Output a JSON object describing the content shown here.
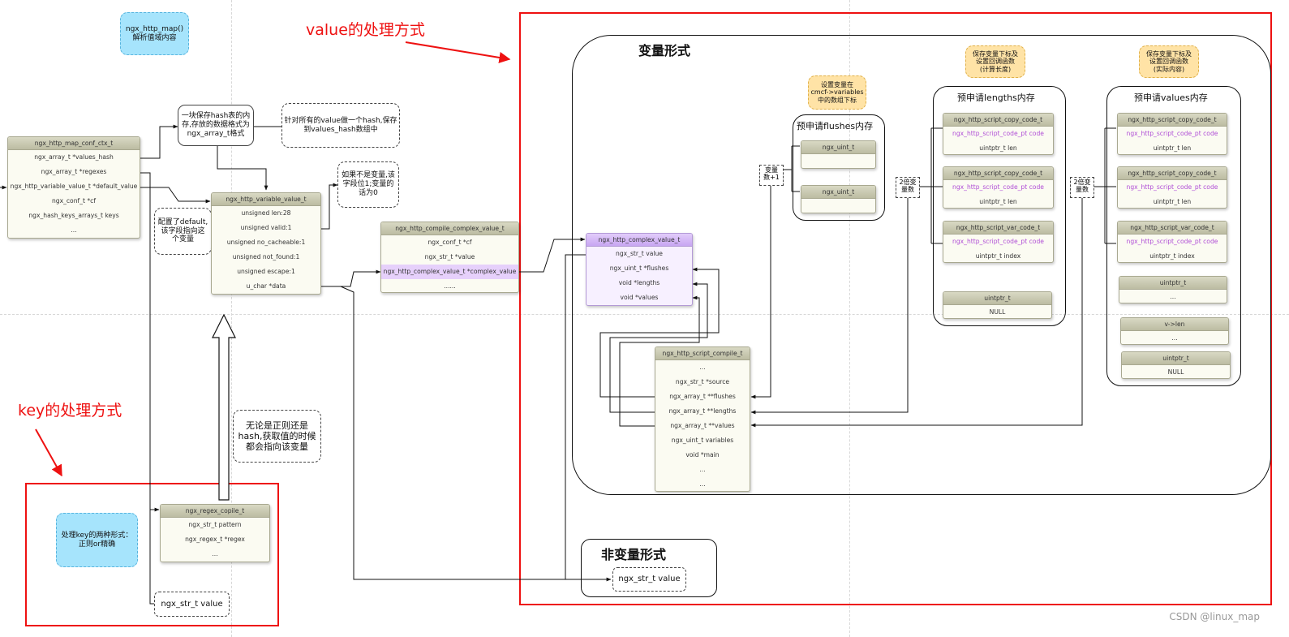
{
  "annotations": {
    "value_title": "value的处理方式",
    "key_title": "key的处理方式",
    "map_parse": "ngx_http_map()\n解析值域内容",
    "key_forms": "处理key的两种形式：\n正则or精确",
    "hash_mem": "一块保存hash表的内\n存,存放的数据格式为\nngx_array_t格式",
    "hash_values": "针对所有的value做一个hash,保存\n到values_hash数组中",
    "not_variable": "如果不是变量,该\n字段位1;变量的\n话为0",
    "default_note": "配置了default,\n该字段指向这\n个变量",
    "regex_note": "无论是正则还是\nhash,获取值的时候\n都会指向该变量",
    "set_var_idx": "设置变量在\ncmcf->variables\n中的数组下标",
    "save_idx_len": "保存变量下标及\n设置回调函数\n(计算长度)",
    "save_idx_real": "保存变量下标及\n设置回调函数\n(实际内容)",
    "var_count_plus1": "变量\n数+1",
    "double_var_count_a": "2倍变\n量数",
    "double_var_count_b": "2倍变\n量数"
  },
  "sections": {
    "variable_form": "变量形式",
    "non_variable_form": "非变量形式",
    "flushes_mem": "预申请flushes内存",
    "lengths_mem": "预申请lengths内存",
    "values_mem": "预申请values内存"
  },
  "structs": {
    "map_conf_ctx": {
      "title": "ngx_http_map_conf_ctx_t",
      "rows": [
        "ngx_array_t *values_hash",
        "ngx_array_t *regexes",
        "ngx_http_variable_value_t *default_value",
        "ngx_conf_t  *cf",
        "ngx_hash_keys_arrays_t  keys",
        "..."
      ]
    },
    "variable_value": {
      "title": "ngx_http_variable_value_t",
      "rows": [
        "unsigned    len:28",
        "unsigned valid:1",
        "unsigned  no_cacheable:1",
        "unsigned not_found:1",
        "unsigned escape:1",
        "u_char *data"
      ]
    },
    "compile_complex": {
      "title": "ngx_http_compile_complex_value_t",
      "rows": [
        "ngx_conf_t  *cf",
        "ngx_str_t  *value",
        "ngx_http_complex_value_t  *complex_value",
        "......"
      ]
    },
    "complex_value": {
      "title": "ngx_http_complex_value_t",
      "rows": [
        "ngx_str_t  value",
        "ngx_uint_t  *flushes",
        "void *lengths",
        "void  *values"
      ]
    },
    "script_compile": {
      "title": "ngx_http_script_compile_t",
      "rows": [
        "...",
        "ngx_str_t *source",
        "ngx_array_t **flushes",
        "ngx_array_t **lengths",
        "ngx_array_t **values",
        "ngx_uint_t variables",
        "void *main",
        "...",
        "..."
      ]
    },
    "regex_compile": {
      "title": "ngx_regex_copile_t",
      "rows": [
        "ngx_str_t pattern",
        "ngx_regex_t *regex",
        "..."
      ]
    },
    "flush1": {
      "title": "ngx_uint_t",
      "rows": [
        ""
      ]
    },
    "flush2": {
      "title": "ngx_uint_t",
      "rows": [
        ""
      ]
    },
    "len_copy1": {
      "title": "ngx_http_script_copy_code_t",
      "rows": [
        "ngx_http_script_code_pt  code",
        "uintptr_t len"
      ]
    },
    "len_copy2": {
      "title": "ngx_http_script_copy_code_t",
      "rows": [
        "ngx_http_script_code_pt  code",
        "uintptr_t len"
      ]
    },
    "len_var": {
      "title": "ngx_http_script_var_code_t",
      "rows": [
        "ngx_http_script_code_pt  code",
        "uintptr_t index"
      ]
    },
    "len_null": {
      "title": "uintptr_t",
      "rows": [
        "NULL"
      ]
    },
    "val_copy1": {
      "title": "ngx_http_script_copy_code_t",
      "rows": [
        "ngx_http_script_code_pt  code",
        "uintptr_t len"
      ]
    },
    "val_copy2": {
      "title": "ngx_http_script_copy_code_t",
      "rows": [
        "ngx_http_script_code_pt  code",
        "uintptr_t len"
      ]
    },
    "val_var": {
      "title": "ngx_http_script_var_code_t",
      "rows": [
        "ngx_http_script_code_pt  code",
        "uintptr_t index"
      ]
    },
    "val_uintptr": {
      "title": "uintptr_t",
      "rows": [
        "..."
      ]
    },
    "val_vlen": {
      "title": "v->len",
      "rows": [
        "..."
      ]
    },
    "val_null": {
      "title": "uintptr_t",
      "rows": [
        "NULL"
      ]
    }
  },
  "str_value_key": "ngx_str_t value",
  "str_value_nonvar": "ngx_str_t value",
  "watermark": "CSDN @linux_map",
  "colors": {
    "red": "#ee1111",
    "purple": "#c8a6f2",
    "blue_note": "#a6e4fc",
    "orange_note": "#ffe3a6",
    "struct_header": "#c9c9b0"
  }
}
